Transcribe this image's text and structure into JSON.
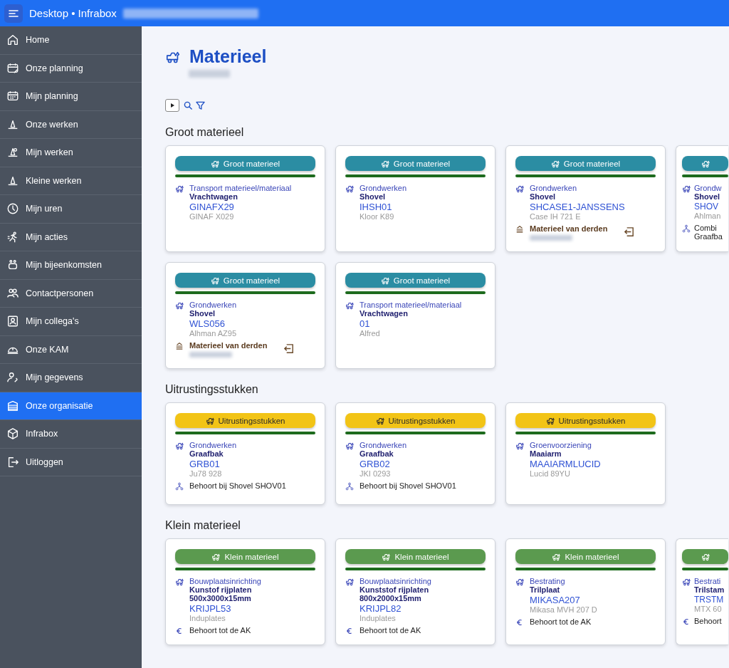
{
  "topbar": {
    "title": "Desktop • Infrabox"
  },
  "sidebar": {
    "items": [
      {
        "label": "Home",
        "selected": false
      },
      {
        "label": "Onze planning",
        "selected": false
      },
      {
        "label": "Mijn planning",
        "selected": false
      },
      {
        "label": "Onze werken",
        "selected": false
      },
      {
        "label": "Mijn werken",
        "selected": false
      },
      {
        "label": "Kleine werken",
        "selected": false
      },
      {
        "label": "Mijn uren",
        "selected": false
      },
      {
        "label": "Mijn acties",
        "selected": false
      },
      {
        "label": "Mijn bijeenkomsten",
        "selected": false
      },
      {
        "label": "Contactpersonen",
        "selected": false
      },
      {
        "label": "Mijn collega's",
        "selected": false
      },
      {
        "label": "Onze KAM",
        "selected": false
      },
      {
        "label": "Mijn gegevens",
        "selected": false
      },
      {
        "label": "Onze organisatie",
        "selected": true
      },
      {
        "label": "Infrabox",
        "selected": false
      },
      {
        "label": "Uitloggen",
        "selected": false
      }
    ]
  },
  "page": {
    "title": "Materieel"
  },
  "sections": [
    {
      "title": "Groot materieel",
      "kind": "groot",
      "cards": [
        {
          "badge": "Groot materieel",
          "category": "Transport materieel/materiaal",
          "type": "Vrachtwagen",
          "code": "GINAFX29",
          "brand": "GINAF X029",
          "cut": false
        },
        {
          "badge": "Groot materieel",
          "category": "Grondwerken",
          "type": "Shovel",
          "code": "IHSH01",
          "brand": "Kloor K89",
          "cut": false
        },
        {
          "badge": "Groot materieel",
          "category": "Grondwerken",
          "type": "Shovel",
          "code": "SHCASE1-JANSSENS",
          "brand": "Case IH 721 E",
          "extra": {
            "kind": "derden",
            "text": "Materieel van derden"
          },
          "cut": false
        },
        {
          "category": "Grondw",
          "type": "Shovel",
          "code": "SHOV",
          "brand": "Ahlman",
          "extra": {
            "kind": "behoort",
            "text": "Combi\nGraafba"
          },
          "cut": true
        },
        {
          "badge": "Groot materieel",
          "category": "Grondwerken",
          "type": "Shovel",
          "code": "WLS056",
          "brand": "Alhman AZ95",
          "extra": {
            "kind": "derden",
            "text": "Materieel van derden"
          },
          "cut": false
        },
        {
          "badge": "Groot materieel",
          "category": "Transport materieel/materiaal",
          "type": "Vrachtwagen",
          "code": "01",
          "brand": "Alfred",
          "cut": false
        }
      ]
    },
    {
      "title": "Uitrustingsstukken",
      "kind": "uitrusting",
      "cards": [
        {
          "badge": "Uitrustingsstukken",
          "category": "Grondwerken",
          "type": "Graafbak",
          "code": "GRB01",
          "brand": "Ju78 928",
          "extra": {
            "kind": "behoort",
            "text": "Behoort bij Shovel SHOV01"
          },
          "cut": false
        },
        {
          "badge": "Uitrustingsstukken",
          "category": "Grondwerken",
          "type": "Graafbak",
          "code": "GRB02",
          "brand": "JKI 0293",
          "extra": {
            "kind": "behoort",
            "text": "Behoort bij Shovel SHOV01"
          },
          "cut": false
        },
        {
          "badge": "Uitrustingsstukken",
          "category": "Groenvoorziening",
          "type": "Maaiarm",
          "code": "MAAIARMLUCID",
          "brand": "Lucid 89YU",
          "cut": false
        }
      ]
    },
    {
      "title": "Klein materieel",
      "kind": "klein",
      "cards": [
        {
          "badge": "Klein materieel",
          "category": "Bouwplaatsinrichting",
          "type": "Kunstof rijplaten\n500x3000x15mm",
          "code": "KRIJPL53",
          "brand": "Induplates",
          "extra": {
            "kind": "ak",
            "text": "Behoort tot de AK"
          },
          "cut": false
        },
        {
          "badge": "Klein materieel",
          "category": "Bouwplaatsinrichting",
          "type": "Kunststof rijplaten\n800x2000x15mm",
          "code": "KRIJPL82",
          "brand": "Induplates",
          "extra": {
            "kind": "ak",
            "text": "Behoort tot de AK"
          },
          "cut": false
        },
        {
          "badge": "Klein materieel",
          "category": "Bestrating",
          "type": "Trilplaat",
          "code": "MIKASA207",
          "brand": "Mikasa MVH 207 D",
          "extra": {
            "kind": "ak",
            "text": "Behoort tot de AK"
          },
          "cut": false
        },
        {
          "category": "Bestrati",
          "type": "Trilstam",
          "code": "TRSTM",
          "brand": "MTX 60",
          "extra": {
            "kind": "ak",
            "text": "Behoort"
          },
          "cut": true
        }
      ]
    }
  ]
}
